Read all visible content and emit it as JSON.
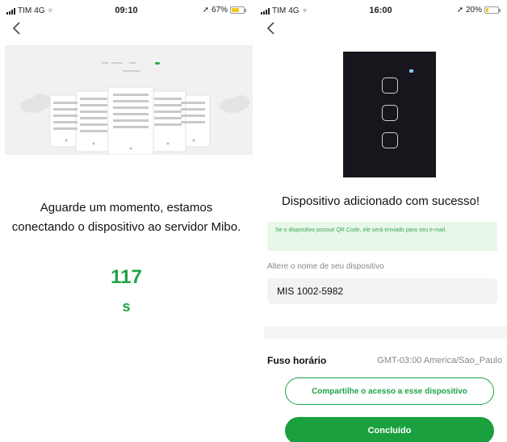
{
  "left_screen": {
    "status": {
      "carrier": "TIM",
      "network": "4G",
      "time": "09:10",
      "battery": "67%",
      "battery_level": 0.67
    },
    "back_icon": "chevron-left-icon",
    "illustration": "servers-connecting-illustration",
    "wait_message": "Aguarde um momento, estamos conectando o dispositivo ao servidor Mibo.",
    "countdown": "117",
    "countdown_unit": "s"
  },
  "right_screen": {
    "status": {
      "carrier": "TIM",
      "network": "4G",
      "time": "16:00",
      "battery": "20%",
      "battery_level": 0.2
    },
    "back_icon": "chevron-left-icon",
    "device_image": "touch-switch-3-buttons",
    "success_title": "Dispositivo adicionado com sucesso!",
    "info_text": "Se o dispositivo possuir QR Code, ele será enviado para seu e-mail.",
    "rename_label": "Altere o nome de seu dispositivo",
    "device_name": "MIS 1002-5982",
    "timezone_label": "Fuso horário",
    "timezone_value": "GMT-03:00 America/Sao_Paulo",
    "share_button": "Compartilhe o acesso a esse dispositivo",
    "done_button": "Concluído"
  },
  "colors": {
    "accent": "#1fa34a",
    "info_bg": "#e8f7ea",
    "device_bg": "#16161c",
    "battery": "#f0c81e"
  }
}
